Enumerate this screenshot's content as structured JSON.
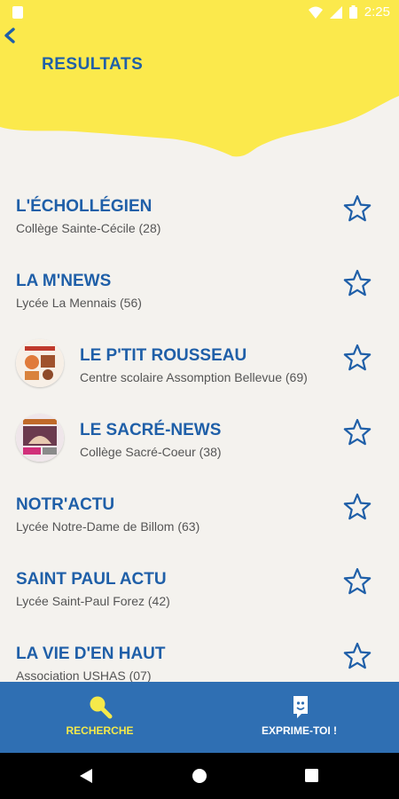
{
  "status_bar": {
    "time": "2:25"
  },
  "header": {
    "title": "RESULTATS"
  },
  "results": [
    {
      "name": "L'ÉCHOLLÉGIEN",
      "school": "Collège Sainte-Cécile (28)"
    },
    {
      "name": "LA M'NEWS",
      "school": "Lycée La Mennais (56)"
    },
    {
      "name": "LE P'TIT ROUSSEAU",
      "school": "Centre scolaire Assomption Bellevue (69)"
    },
    {
      "name": "LE SACRÉ-NEWS",
      "school": "Collège Sacré-Coeur (38)"
    },
    {
      "name": "NOTR'ACTU",
      "school": "Lycée Notre-Dame de Billom (63)"
    },
    {
      "name": "SAINT PAUL ACTU",
      "school": "Lycée Saint-Paul Forez (42)"
    },
    {
      "name": "LA VIE D'EN HAUT",
      "school": "Association USHAS (07)"
    }
  ],
  "bottom_nav": {
    "search_label": "RECHERCHE",
    "express_label": "EXPRIME-TOI !"
  },
  "colors": {
    "accent_yellow": "#fbe94c",
    "title_blue": "#1f5fa8",
    "nav_blue": "#2f6fb3",
    "active_tab": "#f5e94a"
  }
}
